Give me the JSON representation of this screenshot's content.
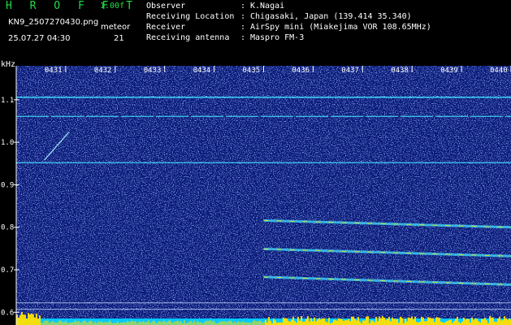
{
  "header": {
    "app_title": "H R O F F T",
    "version": "1.00f",
    "filename": "KN9_2507270430.png",
    "meteor_label": "meteor",
    "datetime": "25.07.27 04:30",
    "meteor_count": "21",
    "info": [
      {
        "key": "Observer",
        "sep": ":",
        "value": "K.Nagai"
      },
      {
        "key": "Receiving Location",
        "sep": ":",
        "value": "Chigasaki, Japan (139.414 35.340)"
      },
      {
        "key": "Receiver",
        "sep": ":",
        "value": "AirSpy mini (Miakejima VOR 108.65MHz)"
      },
      {
        "key": "Receiving antenna",
        "sep": ":",
        "value": "Maspro FM-3"
      }
    ]
  },
  "chart_data": {
    "type": "heatmap",
    "ylabel": "kHz",
    "x_ticks": [
      "0431",
      "0432",
      "0433",
      "0434",
      "0435",
      "0436",
      "0437",
      "0438",
      "0439",
      "0440"
    ],
    "y_ticks": [
      "1.1",
      "1.0",
      "0.9",
      "0.8",
      "0.7",
      "0.6"
    ],
    "ylim": [
      0.57,
      1.18
    ],
    "xlim": [
      "04:30",
      "04:40"
    ],
    "colors": {
      "background": "#0a1a78",
      "noise": "#3a5ad8",
      "signal": "#40e0ff",
      "strong": "#ffe000",
      "baseline": "#00c8ff"
    },
    "horizontal_carriers_khz": [
      1.106,
      1.061,
      0.952
    ],
    "carrier_lines_khz": [
      0.622,
      0.607
    ],
    "drifting_signals": [
      {
        "start_time": "04:35",
        "end_time": "04:40",
        "start_khz": 0.816,
        "end_khz": 0.8
      },
      {
        "start_time": "04:35",
        "end_time": "04:40",
        "start_khz": 0.749,
        "end_khz": 0.732
      },
      {
        "start_time": "04:35",
        "end_time": "04:40",
        "start_khz": 0.683,
        "end_khz": 0.665
      }
    ],
    "meteor_streaks": [
      {
        "start_time": "04:30:34",
        "end_time": "04:31:04",
        "start_khz": 0.958,
        "end_khz": 1.024
      }
    ]
  }
}
